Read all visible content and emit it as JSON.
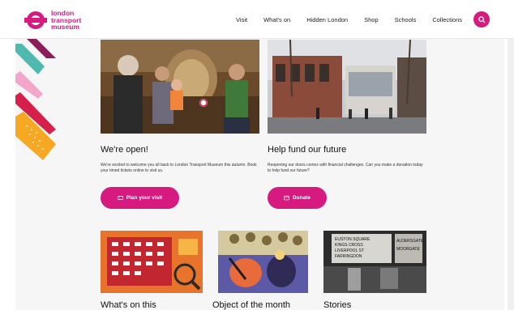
{
  "header": {
    "logo": {
      "line1": "london",
      "line2": "transport",
      "line3": "museum"
    },
    "nav": [
      "Visit",
      "What's on",
      "Hidden London",
      "Shop",
      "Schools",
      "Collections"
    ]
  },
  "cards_top": [
    {
      "title": "We're open!",
      "description": "We're excited to welcome you all back to London Transport Museum this autumn. Book your timed tickets online to visit us.",
      "button_label": "Plan your visit"
    },
    {
      "title": "Help fund our future",
      "description": "Reopening our doors comes with financial challenges. Can you make a donation today to help fund our future?",
      "button_label": "Donate"
    }
  ],
  "cards_bottom": [
    {
      "title": "What's on this"
    },
    {
      "title": "Object of the month"
    },
    {
      "title": "Stories"
    }
  ],
  "stories_poster_text": [
    "EUSTON SQUARE",
    "KINGS CROSS",
    "LIVERPOOL ST",
    "FARRINGDON",
    "ALDERSGATE",
    "MOORGATE"
  ],
  "colors": {
    "brand": "#d61a7f"
  }
}
